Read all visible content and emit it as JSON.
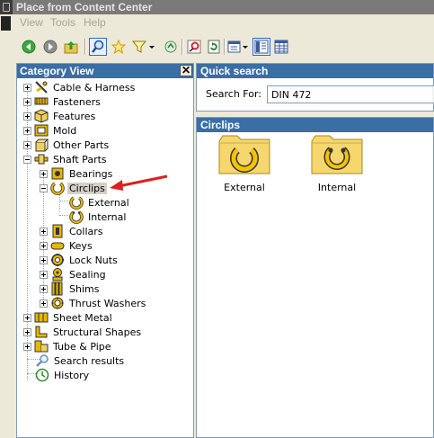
{
  "window": {
    "title": "Place from Content Center"
  },
  "menu": {
    "view": "View",
    "tools": "Tools",
    "help": "Help"
  },
  "toolbar": {
    "buttons": [
      "back-icon",
      "forward-icon",
      "up-folder-icon",
      "search-icon",
      "favorites-icon",
      "filter-icon",
      "refresh-icon",
      "place-icon",
      "update-icon",
      "view-options-icon",
      "tree-view-icon",
      "table-view-icon"
    ]
  },
  "category_view": {
    "title": "Category View",
    "close_glyph": "✕",
    "items": [
      {
        "label": "Cable & Harness"
      },
      {
        "label": "Fasteners"
      },
      {
        "label": "Features"
      },
      {
        "label": "Mold"
      },
      {
        "label": "Other Parts"
      },
      {
        "label": "Shaft Parts"
      },
      {
        "label": "Bearings"
      },
      {
        "label": "Circlips"
      },
      {
        "label": "External"
      },
      {
        "label": "Internal"
      },
      {
        "label": "Collars"
      },
      {
        "label": "Keys"
      },
      {
        "label": "Lock Nuts"
      },
      {
        "label": "Sealing"
      },
      {
        "label": "Shims"
      },
      {
        "label": "Thrust Washers"
      },
      {
        "label": "Sheet Metal"
      },
      {
        "label": "Structural Shapes"
      },
      {
        "label": "Tube & Pipe"
      },
      {
        "label": "Search results"
      },
      {
        "label": "History"
      }
    ],
    "selected": "Circlips"
  },
  "quick_search": {
    "title": "Quick search",
    "search_for_label": "Search For:",
    "value": "DIN 472"
  },
  "content": {
    "title": "Circlips",
    "tiles": [
      {
        "label": "External"
      },
      {
        "label": "Internal"
      }
    ]
  },
  "colors": {
    "header_bg": "#3a6ea5",
    "folder_yellow": "#f5d76e",
    "annotation_arrow": "#e01e1e"
  }
}
